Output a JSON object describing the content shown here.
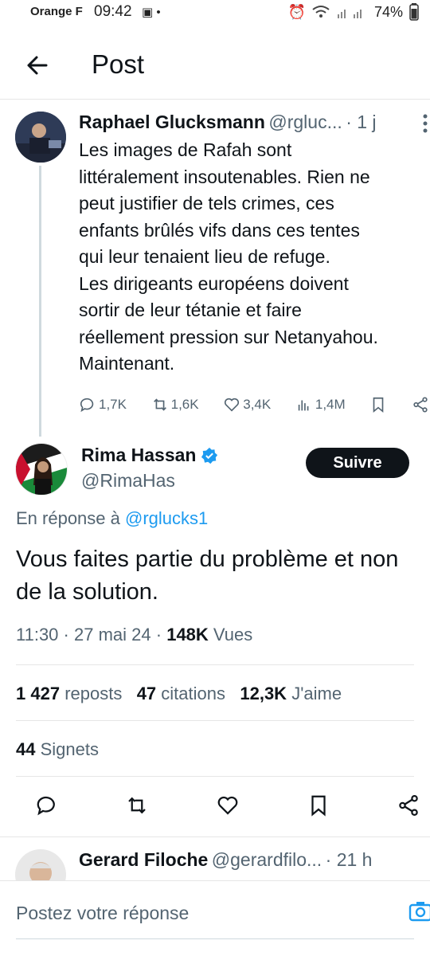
{
  "status_bar": {
    "carrier": "Orange F",
    "time": "09:42",
    "battery": "74%"
  },
  "header": {
    "title": "Post"
  },
  "parent_tweet": {
    "author_name": "Raphael Glucksmann",
    "author_handle": "@rgluc...",
    "time_ago": "· 1 j",
    "text": "Les images de Rafah sont\nlittéralement insoutenables. Rien ne\npeut justifier de tels crimes, ces\nenfants brûlés vifs dans ces tentes\nqui leur tenaient lieu de refuge.\nLes dirigeants européens doivent\nsortir de leur tétanie et faire\nréellement pression sur Netanyahou.\nMaintenant.",
    "replies": "1,7K",
    "reposts": "1,6K",
    "likes": "3,4K",
    "views": "1,4M"
  },
  "main_tweet": {
    "author_name": "Rima Hassan",
    "author_handle": "@RimaHas",
    "follow_label": "Suivre",
    "reply_prefix": "En réponse à",
    "reply_to": "@rglucks1",
    "text": "Vous faites partie du problème et non de la solution.",
    "time": "11:30",
    "date": "27 mai 24",
    "views_count": "148K",
    "views_label": "Vues",
    "reposts_count": "1 427",
    "reposts_label": "reposts",
    "quotes_count": "47",
    "quotes_label": "citations",
    "likes_count": "12,3K",
    "likes_label": "J'aime",
    "bookmarks_count": "44",
    "bookmarks_label": "Signets"
  },
  "next_reply": {
    "author_name": "Gerard Filoche",
    "author_handle": "@gerardfilo...",
    "time_ago": "· 21 h"
  },
  "composer": {
    "placeholder": "Postez votre réponse"
  },
  "colors": {
    "accent": "#1d9bf0",
    "text": "#0f1419",
    "muted": "#536471",
    "verified": "#1d9bf0"
  }
}
